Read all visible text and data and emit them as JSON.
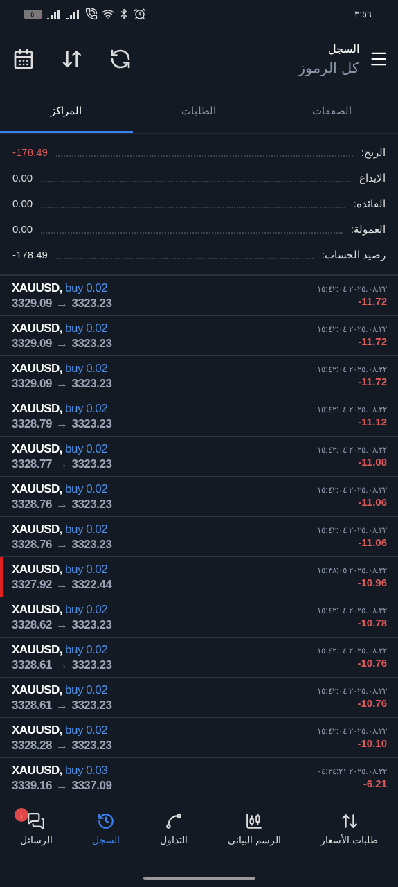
{
  "status_bar": {
    "time": "٣:٥٦",
    "battery": "٥"
  },
  "header": {
    "title": "السجل",
    "subtitle": "كل الرموز"
  },
  "tabs": [
    {
      "label": "الصفقات",
      "selected": false
    },
    {
      "label": "الطلبات",
      "selected": false
    },
    {
      "label": "المراكز",
      "selected": true
    }
  ],
  "summary": [
    {
      "label": "الربح:",
      "value": "-178.49",
      "negative": true
    },
    {
      "label": "الايداع",
      "value": "0.00",
      "negative": false
    },
    {
      "label": "الفائدة:",
      "value": "0.00",
      "negative": false
    },
    {
      "label": "العمولة:",
      "value": "0.00",
      "negative": false
    },
    {
      "label": "رصيد الحساب:",
      "value": "-178.49",
      "negative": false
    }
  ],
  "positions": [
    {
      "symbol": "XAUUSD,",
      "side": "buy 0.02",
      "open": "3329.09",
      "close": "3323.23",
      "arrow": "→",
      "time": "٢٠٢٥.٠٨.٢٢ ١٥:٤٢:٠٤",
      "profit": "-11.72",
      "highlighted": false
    },
    {
      "symbol": "XAUUSD,",
      "side": "buy 0.02",
      "open": "3329.09",
      "close": "3323.23",
      "arrow": "→",
      "time": "٢٠٢٥.٠٨.٢٢ ١٥:٤٢:٠٤",
      "profit": "-11.72",
      "highlighted": false
    },
    {
      "symbol": "XAUUSD,",
      "side": "buy 0.02",
      "open": "3329.09",
      "close": "3323.23",
      "arrow": "→",
      "time": "٢٠٢٥.٠٨.٢٢ ١٥:٤٢:٠٤",
      "profit": "-11.72",
      "highlighted": false
    },
    {
      "symbol": "XAUUSD,",
      "side": "buy 0.02",
      "open": "3328.79",
      "close": "3323.23",
      "arrow": "→",
      "time": "٢٠٢٥.٠٨.٢٢ ١٥:٤٢:٠٤",
      "profit": "-11.12",
      "highlighted": false
    },
    {
      "symbol": "XAUUSD,",
      "side": "buy 0.02",
      "open": "3328.77",
      "close": "3323.23",
      "arrow": "→",
      "time": "٢٠٢٥.٠٨.٢٢ ١٥:٤٢:٠٤",
      "profit": "-11.08",
      "highlighted": false
    },
    {
      "symbol": "XAUUSD,",
      "side": "buy 0.02",
      "open": "3328.76",
      "close": "3323.23",
      "arrow": "→",
      "time": "٢٠٢٥.٠٨.٢٢ ١٥:٤٢:٠٤",
      "profit": "-11.06",
      "highlighted": false
    },
    {
      "symbol": "XAUUSD,",
      "side": "buy 0.02",
      "open": "3328.76",
      "close": "3323.23",
      "arrow": "→",
      "time": "٢٠٢٥.٠٨.٢٢ ١٥:٤٢:٠٤",
      "profit": "-11.06",
      "highlighted": false
    },
    {
      "symbol": "XAUUSD,",
      "side": "buy 0.02",
      "open": "3327.92",
      "close": "3322.44",
      "arrow": "→",
      "time": "٢٠٢٥.٠٨.٢٢ ١٥:٣٨:٠٥",
      "profit": "-10.96",
      "highlighted": true
    },
    {
      "symbol": "XAUUSD,",
      "side": "buy 0.02",
      "open": "3328.62",
      "close": "3323.23",
      "arrow": "→",
      "time": "٢٠٢٥.٠٨.٢٢ ١٥:٤٢:٠٤",
      "profit": "-10.78",
      "highlighted": false
    },
    {
      "symbol": "XAUUSD,",
      "side": "buy 0.02",
      "open": "3328.61",
      "close": "3323.23",
      "arrow": "→",
      "time": "٢٠٢٥.٠٨.٢٢ ١٥:٤٢:٠٤",
      "profit": "-10.76",
      "highlighted": false
    },
    {
      "symbol": "XAUUSD,",
      "side": "buy 0.02",
      "open": "3328.61",
      "close": "3323.23",
      "arrow": "→",
      "time": "٢٠٢٥.٠٨.٢٢ ١٥:٤٢:٠٤",
      "profit": "-10.76",
      "highlighted": false
    },
    {
      "symbol": "XAUUSD,",
      "side": "buy 0.02",
      "open": "3328.28",
      "close": "3323.23",
      "arrow": "→",
      "time": "٢٠٢٥.٠٨.٢٢ ١٥:٤٢:٠٤",
      "profit": "-10.10",
      "highlighted": false
    },
    {
      "symbol": "XAUUSD,",
      "side": "buy 0.03",
      "open": "3339.16",
      "close": "3337.09",
      "arrow": "→",
      "time": "٢٠٢٥.٠٨.٢٢ ٠٤:٢٤:٢١",
      "profit": "-6.21",
      "highlighted": false
    }
  ],
  "nav": [
    {
      "label": "طلبات الأسعار",
      "kind": "quotes",
      "selected": false
    },
    {
      "label": "الرسم البياني",
      "kind": "chart",
      "selected": false
    },
    {
      "label": "التداول",
      "kind": "trade",
      "selected": false
    },
    {
      "label": "السجل",
      "kind": "history",
      "selected": true
    },
    {
      "label": "الرسائل",
      "kind": "messages",
      "selected": false,
      "badge": "١"
    }
  ]
}
